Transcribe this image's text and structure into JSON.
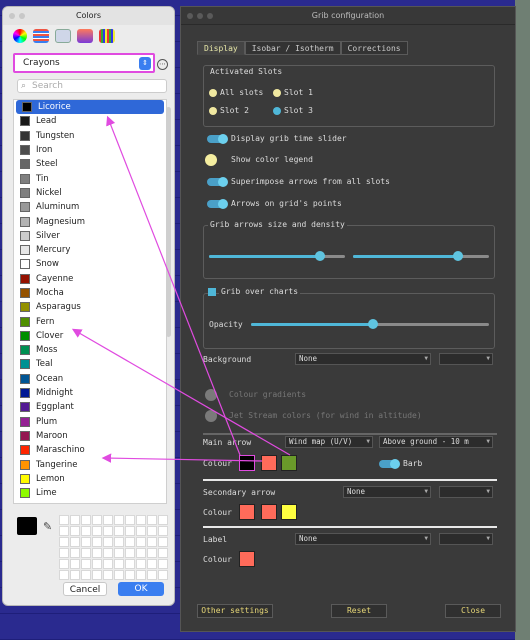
{
  "colors_panel": {
    "title": "Colors",
    "palette_select": "Crayons",
    "search_placeholder": "Search",
    "cancel_label": "Cancel",
    "ok_label": "OK",
    "crayons": [
      {
        "name": "Licorice",
        "color": "#000000"
      },
      {
        "name": "Lead",
        "color": "#191919"
      },
      {
        "name": "Tungsten",
        "color": "#333333"
      },
      {
        "name": "Iron",
        "color": "#4c4c4c"
      },
      {
        "name": "Steel",
        "color": "#666666"
      },
      {
        "name": "Tin",
        "color": "#7f7f7f"
      },
      {
        "name": "Nickel",
        "color": "#808080"
      },
      {
        "name": "Aluminum",
        "color": "#999999"
      },
      {
        "name": "Magnesium",
        "color": "#b3b3b3"
      },
      {
        "name": "Silver",
        "color": "#cccccc"
      },
      {
        "name": "Mercury",
        "color": "#e6e6e6"
      },
      {
        "name": "Snow",
        "color": "#ffffff"
      },
      {
        "name": "Cayenne",
        "color": "#941100"
      },
      {
        "name": "Mocha",
        "color": "#945200"
      },
      {
        "name": "Asparagus",
        "color": "#929000"
      },
      {
        "name": "Fern",
        "color": "#4f8f00"
      },
      {
        "name": "Clover",
        "color": "#008f00"
      },
      {
        "name": "Moss",
        "color": "#009051"
      },
      {
        "name": "Teal",
        "color": "#009193"
      },
      {
        "name": "Ocean",
        "color": "#005493"
      },
      {
        "name": "Midnight",
        "color": "#011993"
      },
      {
        "name": "Eggplant",
        "color": "#531b93"
      },
      {
        "name": "Plum",
        "color": "#942193"
      },
      {
        "name": "Maroon",
        "color": "#941751"
      },
      {
        "name": "Maraschino",
        "color": "#ff2600"
      },
      {
        "name": "Tangerine",
        "color": "#ff9300"
      },
      {
        "name": "Lemon",
        "color": "#fffb00"
      },
      {
        "name": "Lime",
        "color": "#8efa00"
      }
    ],
    "selected": "Licorice"
  },
  "grib": {
    "title": "Grib configuration",
    "tabs": [
      "Display",
      "Isobar / Isotherm",
      "Corrections"
    ],
    "activated_slots": {
      "title": "Activated Slots",
      "all": "All slots",
      "slot1": "Slot 1",
      "slot2": "Slot 2",
      "slot3": "Slot 3"
    },
    "display_time_slider": "Display grib time slider",
    "show_legend": "Show color legend",
    "superimpose": "Superimpose arrows from all slots",
    "arrows_on_points": "Arrows on grid's points",
    "arrows_size_title": "Grib arrows size and density",
    "over_charts_title": "Grib over charts",
    "opacity": "Opacity",
    "background_label": "Background",
    "background_value": "None",
    "colour_gradients": "Colour gradients",
    "jet_stream": "Jet Stream colors (for wind in altitude)",
    "main_arrow_label": "Main arrow",
    "main_arrow_value": "Wind map (U/V)",
    "main_arrow_level": "Above ground - 10 m",
    "colour_label": "Colour",
    "barb_label": "Barb",
    "secondary_arrow_label": "Secondary arrow",
    "secondary_value": "None",
    "label_label": "Label",
    "label_value": "None",
    "other_settings": "Other settings",
    "reset": "Reset",
    "close": "Close"
  }
}
